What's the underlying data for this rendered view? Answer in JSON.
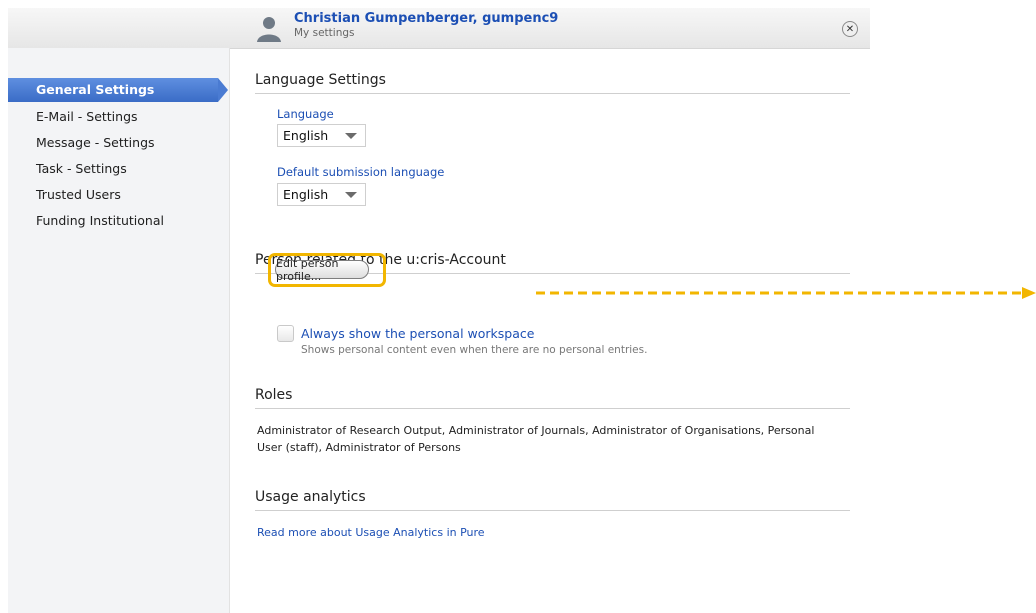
{
  "header": {
    "user_name": "Christian Gumpenberger, gumpenc9",
    "subtitle": "My settings",
    "close_symbol": "✕"
  },
  "sidebar": {
    "items": [
      {
        "label": "General Settings",
        "active": true
      },
      {
        "label": "E-Mail - Settings",
        "active": false
      },
      {
        "label": "Message - Settings",
        "active": false
      },
      {
        "label": "Task - Settings",
        "active": false
      },
      {
        "label": "Trusted Users",
        "active": false
      },
      {
        "label": "Funding Institutional",
        "active": false
      }
    ]
  },
  "language_settings": {
    "title": "Language Settings",
    "language_label": "Language",
    "language_value": "English",
    "submission_label": "Default submission language",
    "submission_value": "English"
  },
  "person_section": {
    "title": "Person related to the u:cris-Account",
    "edit_button": "Edit person profile...",
    "checkbox_label": "Always show the personal workspace",
    "checkbox_description": "Shows personal content even when there are no personal entries.",
    "checkbox_checked": false
  },
  "roles": {
    "title": "Roles",
    "text": "Administrator of Research Output, Administrator of Journals, Administrator of Organisations, Personal User (staff), Administrator of Persons"
  },
  "usage": {
    "title": "Usage analytics",
    "link": "Read more about Usage Analytics in Pure"
  },
  "colors": {
    "accent": "#1c4fb4",
    "active_nav": "#4a7bd2",
    "highlight": "#f2b600"
  },
  "icons": {
    "avatar": "user-silhouette-icon",
    "close": "close-icon",
    "dropdown": "caret-down-icon",
    "arrow": "dashed-arrow-right-icon"
  }
}
